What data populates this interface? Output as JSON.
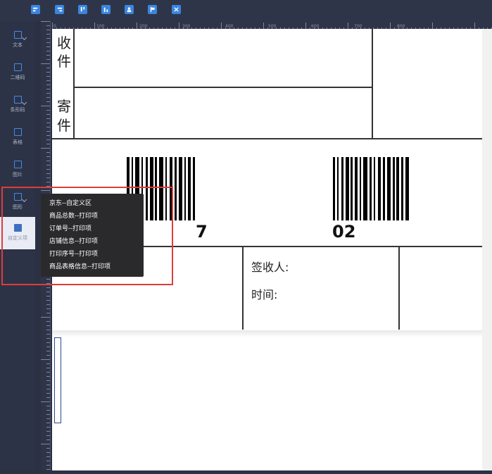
{
  "toolbar": {
    "icons": [
      "align-left-icon",
      "align-right-icon",
      "align-top-icon",
      "align-bottom-icon",
      "person-icon",
      "flag-icon",
      "close-icon"
    ]
  },
  "sidebar": {
    "items": [
      {
        "label": "文本",
        "icon": "text-icon"
      },
      {
        "label": "二维码",
        "icon": "qrcode-icon"
      },
      {
        "label": "条形码",
        "icon": "barcode-icon"
      },
      {
        "label": "表格",
        "icon": "table-icon"
      },
      {
        "label": "图片",
        "icon": "image-icon"
      },
      {
        "label": "图形",
        "icon": "shape-icon"
      },
      {
        "label": "自定义项",
        "icon": "custom-icon"
      }
    ]
  },
  "ruler": {
    "h_labels": [
      "0",
      "100",
      "200",
      "300",
      "400",
      "500",
      "600",
      "700",
      "800"
    ]
  },
  "label": {
    "recipient_1": "收",
    "recipient_2": "件",
    "sender_1": "寄",
    "sender_2": "件",
    "barcode_left_digit": "7",
    "barcode_right_digits": "02",
    "sign_label": "签收人:",
    "time_label": "时间:"
  },
  "popup_menu": {
    "items": [
      "京东--自定义区",
      "商品总数--打印项",
      "订单号--打印项",
      "店铺信息--打印项",
      "打印序号--打印项",
      "商品表格信息--打印项"
    ]
  },
  "colors": {
    "accent": "#3f8cf0",
    "highlight_box": "#e03c3c",
    "sidebar_bg": "#2d3346",
    "popup_bg": "#2a2a2d"
  }
}
